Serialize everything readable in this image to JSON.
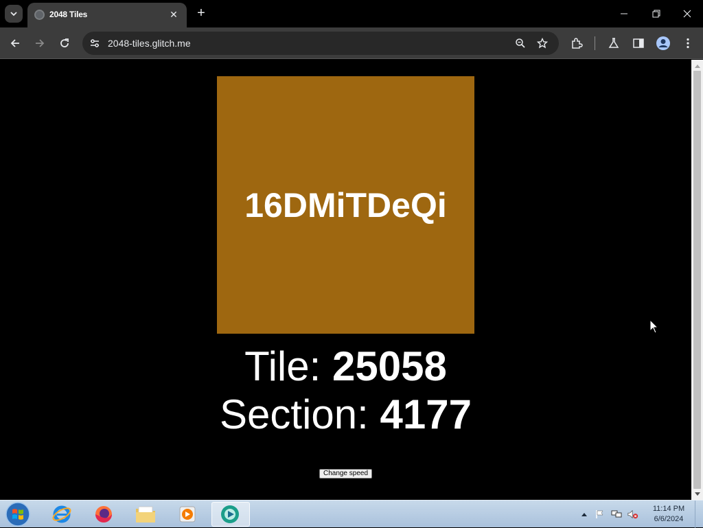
{
  "browser": {
    "tab_title": "2048 Tiles",
    "url": "2048-tiles.glitch.me",
    "new_tab_symbol": "+",
    "tab_close_symbol": "✕"
  },
  "page": {
    "tile_label": "16DMiTDeQi",
    "tile_color": "#9e6710",
    "tile_prefix": "Tile: ",
    "tile_number": "25058",
    "section_prefix": "Section: ",
    "section_number": "4177",
    "change_speed_label": "Change speed"
  },
  "taskbar": {
    "apps": [
      "internet-explorer",
      "firefox",
      "file-explorer",
      "media-player",
      "webcam-app"
    ],
    "time": "11:14 PM",
    "date": "6/6/2024"
  }
}
